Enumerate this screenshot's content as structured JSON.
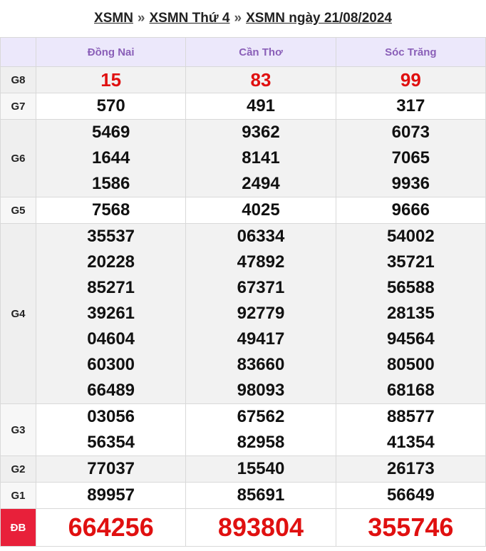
{
  "breadcrumb": {
    "link1": "XSMN",
    "sep": "»",
    "link2": "XSMN Thứ 4",
    "link3": "XSMN ngày 21/08/2024"
  },
  "provinces": [
    "Đồng Nai",
    "Cần Thơ",
    "Sóc Trăng"
  ],
  "prizes": [
    {
      "label": "G8",
      "results": [
        [
          "15"
        ],
        [
          "83"
        ],
        [
          "99"
        ]
      ]
    },
    {
      "label": "G7",
      "results": [
        [
          "570"
        ],
        [
          "491"
        ],
        [
          "317"
        ]
      ]
    },
    {
      "label": "G6",
      "results": [
        [
          "5469",
          "1644",
          "1586"
        ],
        [
          "9362",
          "8141",
          "2494"
        ],
        [
          "6073",
          "7065",
          "9936"
        ]
      ]
    },
    {
      "label": "G5",
      "results": [
        [
          "7568"
        ],
        [
          "4025"
        ],
        [
          "9666"
        ]
      ]
    },
    {
      "label": "G4",
      "results": [
        [
          "35537",
          "20228",
          "85271",
          "39261",
          "04604",
          "60300",
          "66489"
        ],
        [
          "06334",
          "47892",
          "67371",
          "92779",
          "49417",
          "83660",
          "98093"
        ],
        [
          "54002",
          "35721",
          "56588",
          "28135",
          "94564",
          "80500",
          "68168"
        ]
      ]
    },
    {
      "label": "G3",
      "results": [
        [
          "03056",
          "56354"
        ],
        [
          "67562",
          "82958"
        ],
        [
          "88577",
          "41354"
        ]
      ]
    },
    {
      "label": "G2",
      "results": [
        [
          "77037"
        ],
        [
          "15540"
        ],
        [
          "26173"
        ]
      ]
    },
    {
      "label": "G1",
      "results": [
        [
          "89957"
        ],
        [
          "85691"
        ],
        [
          "56649"
        ]
      ]
    },
    {
      "label": "ĐB",
      "results": [
        [
          "664256"
        ],
        [
          "893804"
        ],
        [
          "355746"
        ]
      ]
    }
  ],
  "colors": {
    "header_bg": "#ece8fb",
    "province_text": "#8a5fb8",
    "highlight_red": "#e01010",
    "special_label_bg": "#e8203a"
  }
}
